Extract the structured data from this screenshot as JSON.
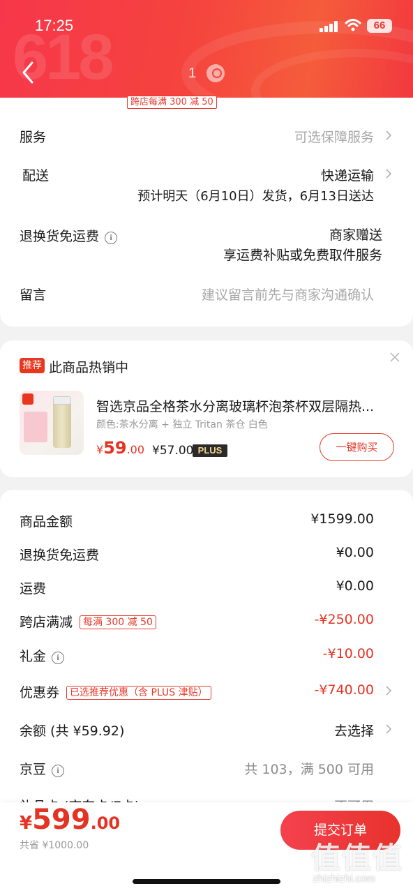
{
  "status": {
    "time": "17:25",
    "battery": "66"
  },
  "header": {
    "watermark": "618",
    "page_indicator": "1"
  },
  "promo_tag": "跨店每满 300 减 50",
  "order_options": {
    "service": {
      "label": "服务",
      "value": "可选保障服务"
    },
    "delivery": {
      "label": "配送",
      "method": "快递运输",
      "estimate": "预计明天（6月10日）发货，6月13日送达"
    },
    "return_shipping": {
      "label": "退换货免运费",
      "line1": "商家赠送",
      "line2": "享运费补贴或免费取件服务"
    },
    "note": {
      "label": "留言",
      "placeholder": "建议留言前先与商家沟通确认"
    }
  },
  "recommendation": {
    "badge": "推荐",
    "title": "此商品热销中",
    "product_name": "智选京品全格茶水分离玻璃杯泡茶杯双层隔热...",
    "spec": "颜色:茶水分离 + 独立 Tritan 茶仓  白色",
    "price_currency": "¥",
    "price_int": "59",
    "price_dec": ".00",
    "plus_price": "¥57.00",
    "plus_tag": "PLUS",
    "buy_button": "一键购买"
  },
  "summary": {
    "goods_amount": {
      "label": "商品金额",
      "value": "¥1599.00"
    },
    "return_shipping": {
      "label": "退换货免运费",
      "value": "¥0.00"
    },
    "shipping": {
      "label": "运费",
      "value": "¥0.00"
    },
    "cross_store": {
      "label": "跨店满减",
      "tag": "每满 300 减 50",
      "value": "-¥250.00"
    },
    "gift_money": {
      "label": "礼金",
      "value": "-¥10.00"
    },
    "coupon": {
      "label": "优惠券",
      "tag": "已选推荐优惠（含 PLUS 津贴）",
      "value": "-¥740.00"
    },
    "balance": {
      "label": "余额 (共 ¥59.92)",
      "value": "去选择"
    },
    "jingdou": {
      "label": "京豆",
      "value": "共 103，满 500 可用"
    },
    "gift_card": {
      "label": "礼品卡 (京东卡/E卡)",
      "value": "不可用"
    }
  },
  "footer": {
    "total_currency": "¥",
    "total_int": "599",
    "total_dec": ".00",
    "saved": "共省 ¥1000.00",
    "submit": "提交订单"
  },
  "watermark": {
    "main": "值值值",
    "sub": "zhizhizhi.com"
  },
  "colors": {
    "accent": "#e53323",
    "header_red": "#f5433e"
  }
}
